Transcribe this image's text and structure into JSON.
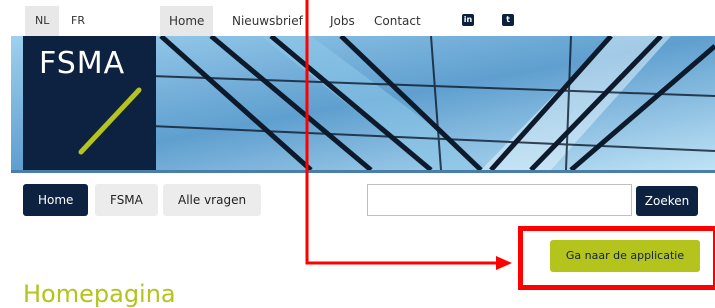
{
  "language_switcher": [
    {
      "label": "NL",
      "active": true
    },
    {
      "label": "FR",
      "active": false
    }
  ],
  "top_nav": [
    {
      "label": "Home",
      "active": true
    },
    {
      "label": "Nieuwsbrief",
      "active": false
    },
    {
      "label": "Jobs",
      "active": false
    },
    {
      "label": "Contact",
      "active": false
    }
  ],
  "social": [
    "linkedin-icon",
    "twitter-icon"
  ],
  "logo": {
    "text": "FSMA"
  },
  "main_nav": [
    {
      "label": "Home",
      "active": true
    },
    {
      "label": "FSMA",
      "active": false
    },
    {
      "label": "Alle vragen",
      "active": false
    }
  ],
  "search": {
    "value": "",
    "placeholder": "",
    "button_label": "Zoeken"
  },
  "app_button": {
    "label": "Ga naar de applicatie"
  },
  "page": {
    "title": "Homepagina"
  },
  "colors": {
    "navy": "#0d2240",
    "lime": "#b4c41c",
    "highlight": "#ff0000"
  }
}
